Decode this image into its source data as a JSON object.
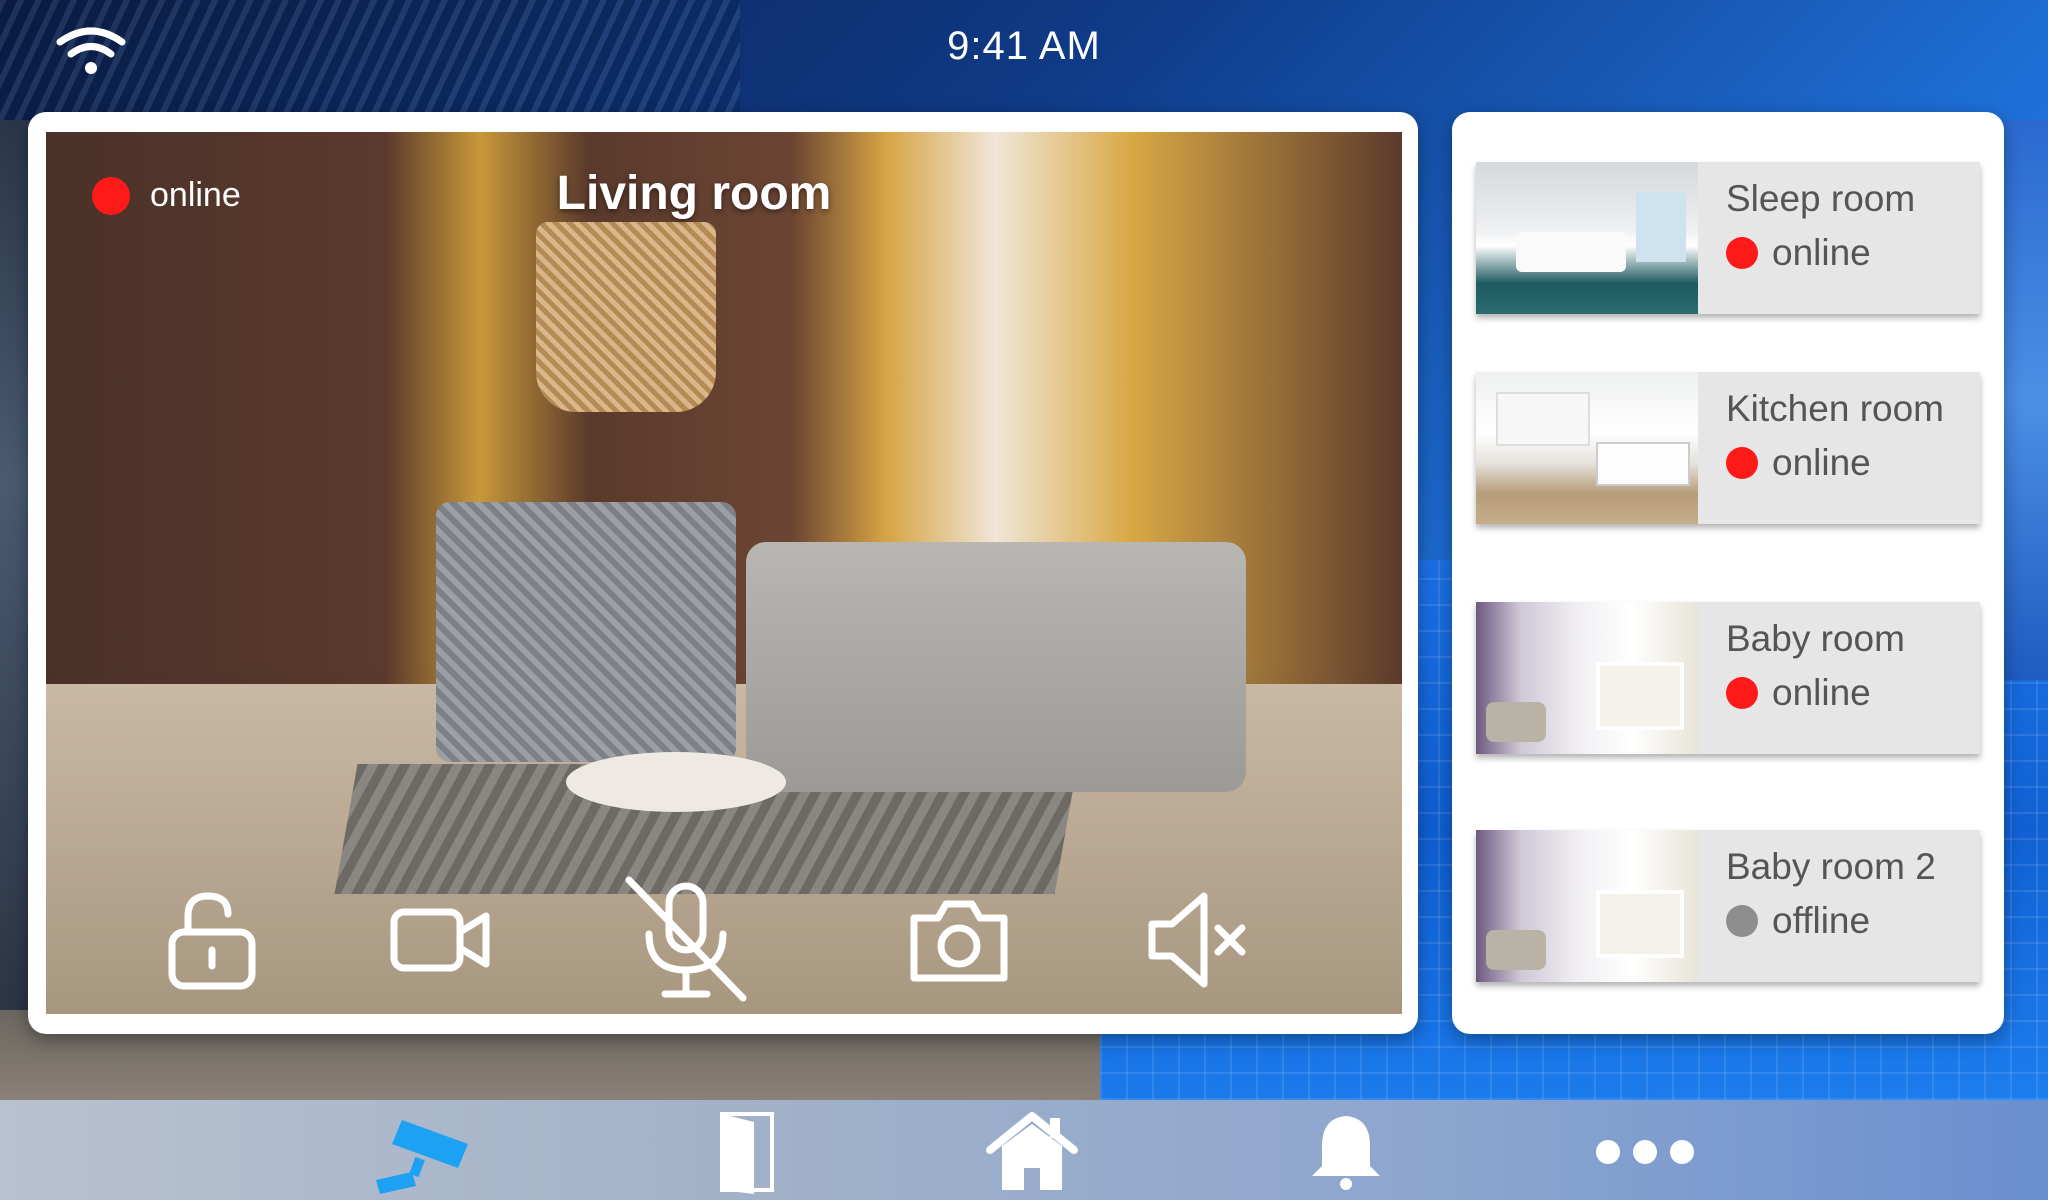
{
  "status_bar": {
    "time": "9:41 AM",
    "wifi_icon": "wifi-icon"
  },
  "main_camera": {
    "title": "Living room",
    "status": "online",
    "status_color": "#ff1a1a",
    "controls": [
      {
        "name": "unlock-icon"
      },
      {
        "name": "video-camera-icon"
      },
      {
        "name": "microphone-muted-icon"
      },
      {
        "name": "camera-snapshot-icon"
      },
      {
        "name": "speaker-muted-icon"
      }
    ]
  },
  "rooms": [
    {
      "name": "Sleep room",
      "status": "online",
      "status_color": "#ff1a1a"
    },
    {
      "name": "Kitchen room",
      "status": "online",
      "status_color": "#ff1a1a"
    },
    {
      "name": "Baby room",
      "status": "online",
      "status_color": "#ff1a1a"
    },
    {
      "name": "Baby room 2",
      "status": "offline",
      "status_color": "#8e8e8e"
    }
  ],
  "nav": [
    {
      "name": "security-camera-icon",
      "active": true,
      "color": "#1da1f2"
    },
    {
      "name": "door-icon",
      "active": false
    },
    {
      "name": "home-icon",
      "active": false
    },
    {
      "name": "bell-icon",
      "active": false
    },
    {
      "name": "more-icon",
      "active": false
    }
  ]
}
